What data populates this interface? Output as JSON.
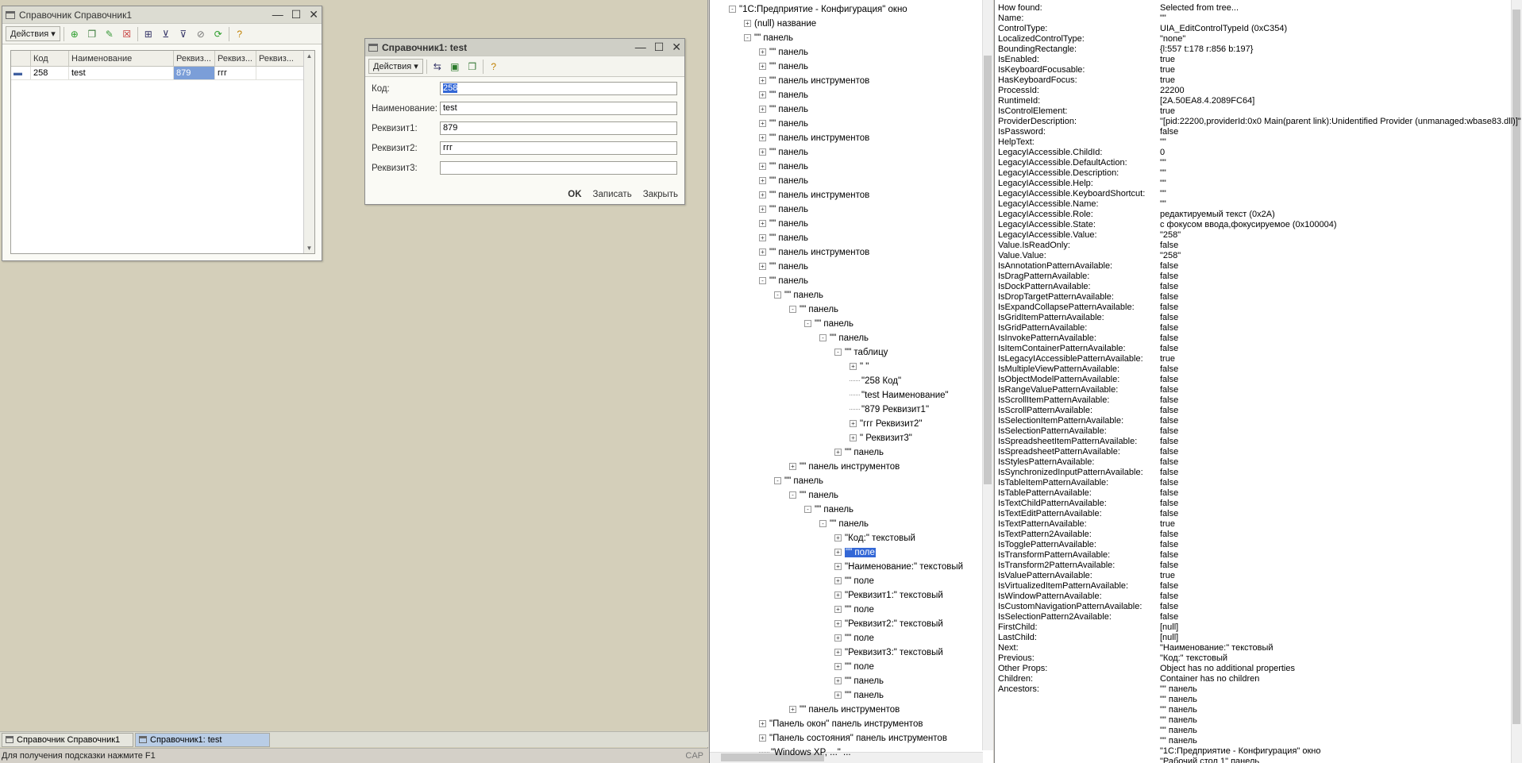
{
  "list_window": {
    "title": "Справочник Справочник1",
    "actions_label": "Действия",
    "columns": [
      "Код",
      "Наименование",
      "Реквиз...",
      "Реквиз...",
      "Реквиз..."
    ],
    "rows": [
      [
        "258",
        "test",
        "879",
        "ггг",
        ""
      ]
    ]
  },
  "form_window": {
    "title": "Справочник1: test",
    "actions_label": "Действия",
    "fields": [
      {
        "label": "Код:",
        "value": "258"
      },
      {
        "label": "Наименование:",
        "value": "test"
      },
      {
        "label": "Реквизит1:",
        "value": "879"
      },
      {
        "label": "Реквизит2:",
        "value": "ггг"
      },
      {
        "label": "Реквизит3:",
        "value": ""
      }
    ],
    "ok_label": "OK",
    "save_label": "Записать",
    "close_label": "Закрыть"
  },
  "taskbar": {
    "items": [
      "Справочник Справочник1",
      "Справочник1: test"
    ]
  },
  "statusbar": {
    "hint": "Для получения подсказки нажмите F1",
    "cap": "CAP"
  },
  "tree": {
    "nodes": [
      {
        "text": "\"1С:Предприятие - Конфигурация\" окно",
        "level": 1,
        "exp": "-"
      },
      {
        "text": "(null) название",
        "level": 2,
        "exp": "+"
      },
      {
        "text": "\"\" панель",
        "level": 2,
        "exp": "-"
      },
      {
        "text": "\"\" панель",
        "level": 3,
        "exp": "+"
      },
      {
        "text": "\"\" панель",
        "level": 3,
        "exp": "+"
      },
      {
        "text": "\"\" панель инструментов",
        "level": 3,
        "exp": "+"
      },
      {
        "text": "\"\" панель",
        "level": 3,
        "exp": "+"
      },
      {
        "text": "\"\" панель",
        "level": 3,
        "exp": "+"
      },
      {
        "text": "\"\" панель",
        "level": 3,
        "exp": "+"
      },
      {
        "text": "\"\" панель инструментов",
        "level": 3,
        "exp": "+"
      },
      {
        "text": "\"\" панель",
        "level": 3,
        "exp": "+"
      },
      {
        "text": "\"\" панель",
        "level": 3,
        "exp": "+"
      },
      {
        "text": "\"\" панель",
        "level": 3,
        "exp": "+"
      },
      {
        "text": "\"\" панель инструментов",
        "level": 3,
        "exp": "+"
      },
      {
        "text": "\"\" панель",
        "level": 3,
        "exp": "+"
      },
      {
        "text": "\"\" панель",
        "level": 3,
        "exp": "+"
      },
      {
        "text": "\"\" панель",
        "level": 3,
        "exp": "+"
      },
      {
        "text": "\"\" панель инструментов",
        "level": 3,
        "exp": "+"
      },
      {
        "text": "\"\" панель",
        "level": 3,
        "exp": "+"
      },
      {
        "text": "\"\" панель",
        "level": 3,
        "exp": "-"
      },
      {
        "text": "\"\" панель",
        "level": 4,
        "exp": "-"
      },
      {
        "text": "\"\" панель",
        "level": 5,
        "exp": "-"
      },
      {
        "text": "\"\" панель",
        "level": 6,
        "exp": "-"
      },
      {
        "text": "\"\" панель",
        "level": 7,
        "exp": "-"
      },
      {
        "text": "\"\" таблицу",
        "level": 8,
        "exp": "-"
      },
      {
        "text": "\" \"",
        "level": 9,
        "exp": "+"
      },
      {
        "text": "\"258 Код\"",
        "level": 9,
        "exp": ""
      },
      {
        "text": "\"test Наименование\"",
        "level": 9,
        "exp": ""
      },
      {
        "text": "\"879 Реквизит1\"",
        "level": 9,
        "exp": ""
      },
      {
        "text": "\"ггг Реквизит2\"",
        "level": 9,
        "exp": "+"
      },
      {
        "text": "\" Реквизит3\"",
        "level": 9,
        "exp": "+"
      },
      {
        "text": "\"\" панель",
        "level": 8,
        "exp": "+"
      },
      {
        "text": "\"\" панель инструментов",
        "level": 5,
        "exp": "+"
      },
      {
        "text": "\"\" панель",
        "level": 4,
        "exp": "-"
      },
      {
        "text": "\"\" панель",
        "level": 5,
        "exp": "-"
      },
      {
        "text": "\"\" панель",
        "level": 6,
        "exp": "-"
      },
      {
        "text": "\"\" панель",
        "level": 7,
        "exp": "-"
      },
      {
        "text": "\"Код:\" текстовый",
        "level": 8,
        "exp": "+"
      },
      {
        "text": "\"\" поле",
        "level": 8,
        "exp": "+",
        "selected": true
      },
      {
        "text": "\"Наименование:\" текстовый",
        "level": 8,
        "exp": "+"
      },
      {
        "text": "\"\" поле",
        "level": 8,
        "exp": "+"
      },
      {
        "text": "\"Реквизит1:\" текстовый",
        "level": 8,
        "exp": "+"
      },
      {
        "text": "\"\" поле",
        "level": 8,
        "exp": "+"
      },
      {
        "text": "\"Реквизит2:\" текстовый",
        "level": 8,
        "exp": "+"
      },
      {
        "text": "\"\" поле",
        "level": 8,
        "exp": "+"
      },
      {
        "text": "\"Реквизит3:\" текстовый",
        "level": 8,
        "exp": "+"
      },
      {
        "text": "\"\" поле",
        "level": 8,
        "exp": "+"
      },
      {
        "text": "\"\" панель",
        "level": 8,
        "exp": "+"
      },
      {
        "text": "\"\" панель",
        "level": 8,
        "exp": "+"
      },
      {
        "text": "\"\" панель инструментов",
        "level": 5,
        "exp": "+"
      },
      {
        "text": "\"Панель окон\" панель инструментов",
        "level": 3,
        "exp": "+"
      },
      {
        "text": "\"Панель состояния\" панель инструментов",
        "level": 3,
        "exp": "+"
      },
      {
        "text": "\"Windows XP, ...\" ...",
        "level": 3,
        "exp": ""
      }
    ]
  },
  "props": [
    [
      "How found:",
      "Selected from tree..."
    ],
    [
      "Name:",
      "\"\""
    ],
    [
      "ControlType:",
      "UIA_EditControlTypeId (0xC354)"
    ],
    [
      "LocalizedControlType:",
      "\"none\""
    ],
    [
      "BoundingRectangle:",
      "{l:557 t:178 r:856 b:197}"
    ],
    [
      "IsEnabled:",
      "true"
    ],
    [
      "IsKeyboardFocusable:",
      "true"
    ],
    [
      "HasKeyboardFocus:",
      "true"
    ],
    [
      "ProcessId:",
      "22200"
    ],
    [
      "RuntimeId:",
      "[2A.50EA8.4.2089FC64]"
    ],
    [
      "IsControlElement:",
      "true"
    ],
    [
      "ProviderDescription:",
      "\"[pid:22200,providerId:0x0 Main(parent link):Unidentified Provider (unmanaged:wbase83.dll)]\""
    ],
    [
      "IsPassword:",
      "false"
    ],
    [
      "HelpText:",
      "\"\""
    ],
    [
      "LegacyIAccessible.ChildId:",
      "0"
    ],
    [
      "LegacyIAccessible.DefaultAction:",
      "\"\""
    ],
    [
      "LegacyIAccessible.Description:",
      "\"\""
    ],
    [
      "LegacyIAccessible.Help:",
      "\"\""
    ],
    [
      "LegacyIAccessible.KeyboardShortcut:",
      "\"\""
    ],
    [
      "LegacyIAccessible.Name:",
      "\"\""
    ],
    [
      "LegacyIAccessible.Role:",
      "редактируемый текст (0x2A)"
    ],
    [
      "LegacyIAccessible.State:",
      "с фокусом ввода,фокусируемое (0x100004)"
    ],
    [
      "LegacyIAccessible.Value:",
      "\"258\""
    ],
    [
      "Value.IsReadOnly:",
      "false"
    ],
    [
      "Value.Value:",
      "\"258\""
    ],
    [
      "IsAnnotationPatternAvailable:",
      "false"
    ],
    [
      "IsDragPatternAvailable:",
      "false"
    ],
    [
      "IsDockPatternAvailable:",
      "false"
    ],
    [
      "IsDropTargetPatternAvailable:",
      "false"
    ],
    [
      "IsExpandCollapsePatternAvailable:",
      "false"
    ],
    [
      "IsGridItemPatternAvailable:",
      "false"
    ],
    [
      "IsGridPatternAvailable:",
      "false"
    ],
    [
      "IsInvokePatternAvailable:",
      "false"
    ],
    [
      "IsItemContainerPatternAvailable:",
      "false"
    ],
    [
      "IsLegacyIAccessiblePatternAvailable:",
      "true"
    ],
    [
      "IsMultipleViewPatternAvailable:",
      "false"
    ],
    [
      "IsObjectModelPatternAvailable:",
      "false"
    ],
    [
      "IsRangeValuePatternAvailable:",
      "false"
    ],
    [
      "IsScrollItemPatternAvailable:",
      "false"
    ],
    [
      "IsScrollPatternAvailable:",
      "false"
    ],
    [
      "IsSelectionItemPatternAvailable:",
      "false"
    ],
    [
      "IsSelectionPatternAvailable:",
      "false"
    ],
    [
      "IsSpreadsheetItemPatternAvailable:",
      "false"
    ],
    [
      "IsSpreadsheetPatternAvailable:",
      "false"
    ],
    [
      "IsStylesPatternAvailable:",
      "false"
    ],
    [
      "IsSynchronizedInputPatternAvailable:",
      "false"
    ],
    [
      "IsTableItemPatternAvailable:",
      "false"
    ],
    [
      "IsTablePatternAvailable:",
      "false"
    ],
    [
      "IsTextChildPatternAvailable:",
      "false"
    ],
    [
      "IsTextEditPatternAvailable:",
      "false"
    ],
    [
      "IsTextPatternAvailable:",
      "true"
    ],
    [
      "IsTextPattern2Available:",
      "false"
    ],
    [
      "IsTogglePatternAvailable:",
      "false"
    ],
    [
      "IsTransformPatternAvailable:",
      "false"
    ],
    [
      "IsTransform2PatternAvailable:",
      "false"
    ],
    [
      "IsValuePatternAvailable:",
      "true"
    ],
    [
      "IsVirtualizedItemPatternAvailable:",
      "false"
    ],
    [
      "IsWindowPatternAvailable:",
      "false"
    ],
    [
      "IsCustomNavigationPatternAvailable:",
      "false"
    ],
    [
      "IsSelectionPattern2Available:",
      "false"
    ],
    [
      "FirstChild:",
      "[null]"
    ],
    [
      "LastChild:",
      "[null]"
    ],
    [
      "Next:",
      "\"Наименование:\" текстовый"
    ],
    [
      "Previous:",
      "\"Код:\" текстовый"
    ],
    [
      "Other Props:",
      "Object has no additional properties"
    ],
    [
      "Children:",
      "Container has no children"
    ],
    [
      "Ancestors:",
      "\"\" панель"
    ],
    [
      "",
      "\"\" панель"
    ],
    [
      "",
      "\"\" панель"
    ],
    [
      "",
      "\"\" панель"
    ],
    [
      "",
      "\"\" панель"
    ],
    [
      "",
      "\"\" панель"
    ],
    [
      "",
      "\"1С:Предприятие - Конфигурация\" окно"
    ],
    [
      "",
      "\"Рабочий стол 1\" панель"
    ]
  ]
}
